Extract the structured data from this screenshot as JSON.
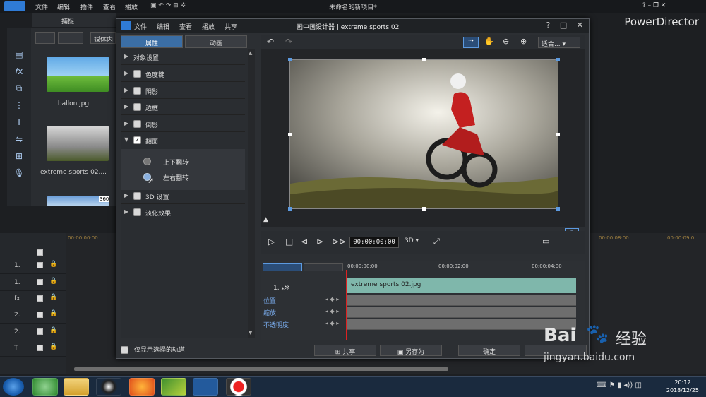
{
  "app": {
    "menu": [
      "文件",
      "编辑",
      "插件",
      "查看",
      "播放"
    ],
    "title": "未命名的新项目*",
    "brand": "PowerDirector",
    "capture_tab": "捕捉",
    "media_content": "媒体内",
    "thumbs": [
      {
        "label": "ballon.jpg"
      },
      {
        "label": "extreme sports 02...."
      },
      {
        "label": "",
        "badge": "360"
      }
    ],
    "timeline_times": [
      "00:00:00:00",
      "00:00:08:00",
      "00:00:09:0"
    ],
    "track_nums": [
      "1.",
      "1.",
      "fx",
      "2.",
      "2.",
      "T"
    ]
  },
  "dialog": {
    "menu": [
      "文件",
      "编辑",
      "查看",
      "播放",
      "共享"
    ],
    "title": "画中画设计器 | extreme sports 02",
    "ctrl": [
      "?",
      "□",
      "✕"
    ],
    "tabs": [
      "属性",
      "动画"
    ],
    "props": [
      {
        "label": "对象设置",
        "arrow": "▶",
        "cb": false
      },
      {
        "label": "色度键",
        "arrow": "▶",
        "cb": true
      },
      {
        "label": "阴影",
        "arrow": "▶",
        "cb": true
      },
      {
        "label": "边框",
        "arrow": "▶",
        "cb": true
      },
      {
        "label": "倒影",
        "arrow": "▶",
        "cb": true
      },
      {
        "label": "翻面",
        "arrow": "▼",
        "cb": true,
        "checked": true
      },
      {
        "label": "3D 设置",
        "arrow": "▶",
        "cb": true
      },
      {
        "label": "淡化效果",
        "arrow": "▶",
        "cb": true
      }
    ],
    "flip_options": [
      "上下翻转",
      "左右翻转"
    ],
    "only_selected": "仅显示选择的轨道",
    "zoom_fit": "适合...",
    "timecode": "00:00:00:00",
    "mode3d": "3D ▾",
    "clip_times": [
      "00:00:00:00",
      "00:00:02:00",
      "00:00:04:00"
    ],
    "track_label": "1. ⁎✻",
    "clip_name": "extreme sports 02.jpg",
    "kf_labels": [
      "位置",
      "缩放",
      "不透明度"
    ],
    "buttons": [
      "共享",
      "另存为",
      "确定",
      ""
    ]
  },
  "taskbar": {
    "time": "20:12",
    "date": "2018/12/25"
  },
  "watermark": {
    "text1": "Bai",
    "text2": "经验",
    "url": "jingyan.baidu.com"
  }
}
